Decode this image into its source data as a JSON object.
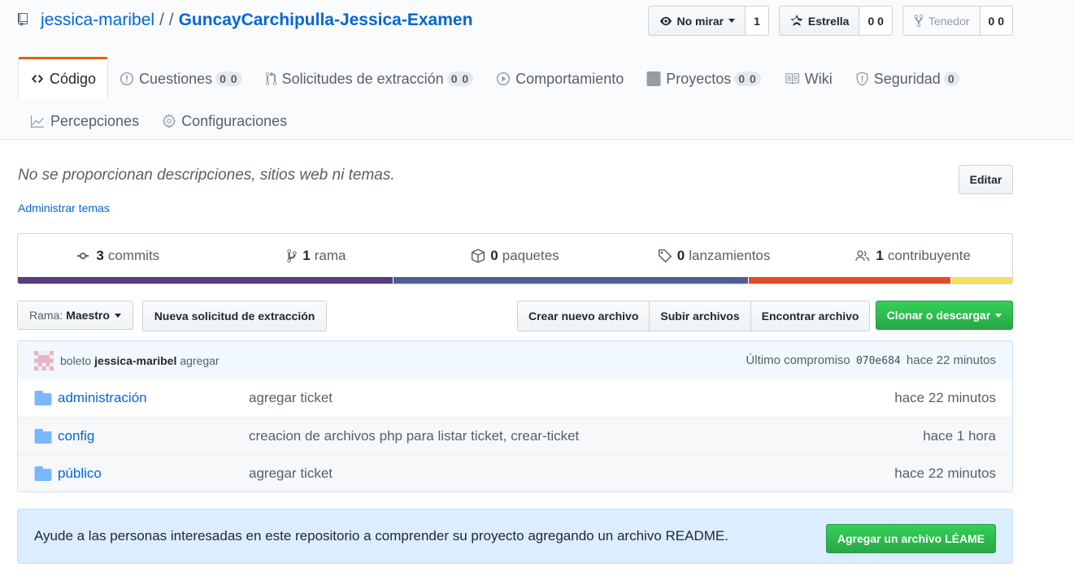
{
  "repo": {
    "owner": "jessica-maribel",
    "separator": "/ /",
    "name": "GuncayCarchipulla-Jessica-Examen"
  },
  "actions": {
    "watch": {
      "label": "No mirar",
      "count": "1"
    },
    "star": {
      "label": "Estrella",
      "count": "0 0"
    },
    "fork": {
      "label": "Tenedor",
      "count": "0 0"
    }
  },
  "tabs": [
    {
      "label": "Código",
      "counter": "",
      "icon": "code-icon",
      "selected": true
    },
    {
      "label": "Cuestiones",
      "counter": "0 0",
      "icon": "issue-icon"
    },
    {
      "label": "Solicitudes de extracción",
      "counter": "0 0",
      "icon": "pull-request-icon"
    },
    {
      "label": "Comportamiento",
      "counter": "",
      "icon": "play-icon"
    },
    {
      "label": "Proyectos",
      "counter": "0 0",
      "icon": "project-icon"
    },
    {
      "label": "Wiki",
      "counter": "",
      "icon": "book-icon"
    },
    {
      "label": "Seguridad",
      "counter": "0",
      "icon": "shield-icon"
    },
    {
      "label": "Percepciones",
      "counter": "",
      "icon": "graph-icon"
    },
    {
      "label": "Configuraciones",
      "counter": "",
      "icon": "gear-icon"
    }
  ],
  "description": {
    "text": "No se proporcionan descripciones, sitios web ni temas.",
    "manage_topics": "Administrar temas",
    "edit": "Editar"
  },
  "summary": {
    "commits": {
      "num": "3",
      "label": "commits"
    },
    "branches": {
      "num": "1",
      "label": "rama"
    },
    "packages": {
      "num": "0",
      "label": "paquetes"
    },
    "releases": {
      "num": "0",
      "label": "lanzamientos"
    },
    "contributors": {
      "num": "1",
      "label": "contribuyente"
    },
    "languages": [
      {
        "color": "#563d7c",
        "percent": 37.7
      },
      {
        "color": "#4F5D95",
        "percent": 35.7
      },
      {
        "color": "#e34c26",
        "percent": 20.4
      },
      {
        "color": "#f1e05a",
        "percent": 6.2
      }
    ]
  },
  "filenav": {
    "branch_prefix": "Rama:",
    "branch_name": "Maestro",
    "new_pr": "Nueva solicitud de extracción",
    "create_file": "Crear nuevo archivo",
    "upload_files": "Subir archivos",
    "find_file": "Encontrar archivo",
    "clone": "Clonar o descargar"
  },
  "commit": {
    "prefix": "boleto",
    "author": "jessica-maribel",
    "message": "agregar",
    "latest_label": "Último compromiso",
    "sha": "070e684",
    "age": "hace 22 minutos"
  },
  "files": [
    {
      "name": "administración",
      "message": "agregar ticket",
      "age": "hace 22 minutos"
    },
    {
      "name": "config",
      "message": "creacion de archivos php para listar ticket, crear-ticket",
      "age": "hace 1 hora"
    },
    {
      "name": "público",
      "message": "agregar ticket",
      "age": "hace 22 minutos"
    }
  ],
  "readme": {
    "text": "Ayude a las personas interesadas en este repositorio a comprender su proyecto agregando un archivo README.",
    "button": "Agregar un archivo LÉAME"
  }
}
